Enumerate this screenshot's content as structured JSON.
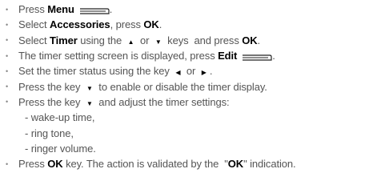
{
  "instructions": [
    {
      "parts": [
        {
          "t": "Press "
        },
        {
          "b": "Menu"
        },
        {
          "icon": "softkey-icon"
        },
        {
          "t": "."
        }
      ]
    },
    {
      "parts": [
        {
          "t": "Select "
        },
        {
          "b": "Accessories"
        },
        {
          "t": ", press "
        },
        {
          "b": "OK"
        },
        {
          "t": "."
        }
      ]
    },
    {
      "parts": [
        {
          "t": "Select "
        },
        {
          "b": "Timer"
        },
        {
          "t": " using the "
        },
        {
          "icon": "up-arrow-icon"
        },
        {
          "t": " or "
        },
        {
          "icon": "down-arrow-icon"
        },
        {
          "t": " keys  and press "
        },
        {
          "b": "OK"
        },
        {
          "t": "."
        }
      ]
    },
    {
      "parts": [
        {
          "t": "The timer setting screen is displayed, press "
        },
        {
          "b": "Edit"
        },
        {
          "icon": "softkey-icon"
        },
        {
          "t": "."
        }
      ]
    },
    {
      "parts": [
        {
          "t": "Set the timer status using the key "
        },
        {
          "icon": "left-arrow-icon"
        },
        {
          "t": " or "
        },
        {
          "icon": "right-arrow-icon"
        },
        {
          "t": "."
        }
      ]
    },
    {
      "parts": [
        {
          "t": "Press the key "
        },
        {
          "icon": "down-arrow-icon"
        },
        {
          "t": " to enable or disable the timer display."
        }
      ]
    },
    {
      "parts": [
        {
          "t": "Press the key "
        },
        {
          "icon": "down-arrow-icon"
        },
        {
          "t": " and adjust the timer settings:"
        }
      ]
    }
  ],
  "sub_items": [
    "- wake-up time,",
    "- ring tone,",
    "- ringer volume."
  ],
  "final_instruction": {
    "parts": [
      {
        "t": "Press "
      },
      {
        "b": "OK"
      },
      {
        "t": " key. The action is validated by the  \""
      },
      {
        "b": "OK"
      },
      {
        "t": "\" indication."
      }
    ]
  },
  "bullet_glyph": "•"
}
